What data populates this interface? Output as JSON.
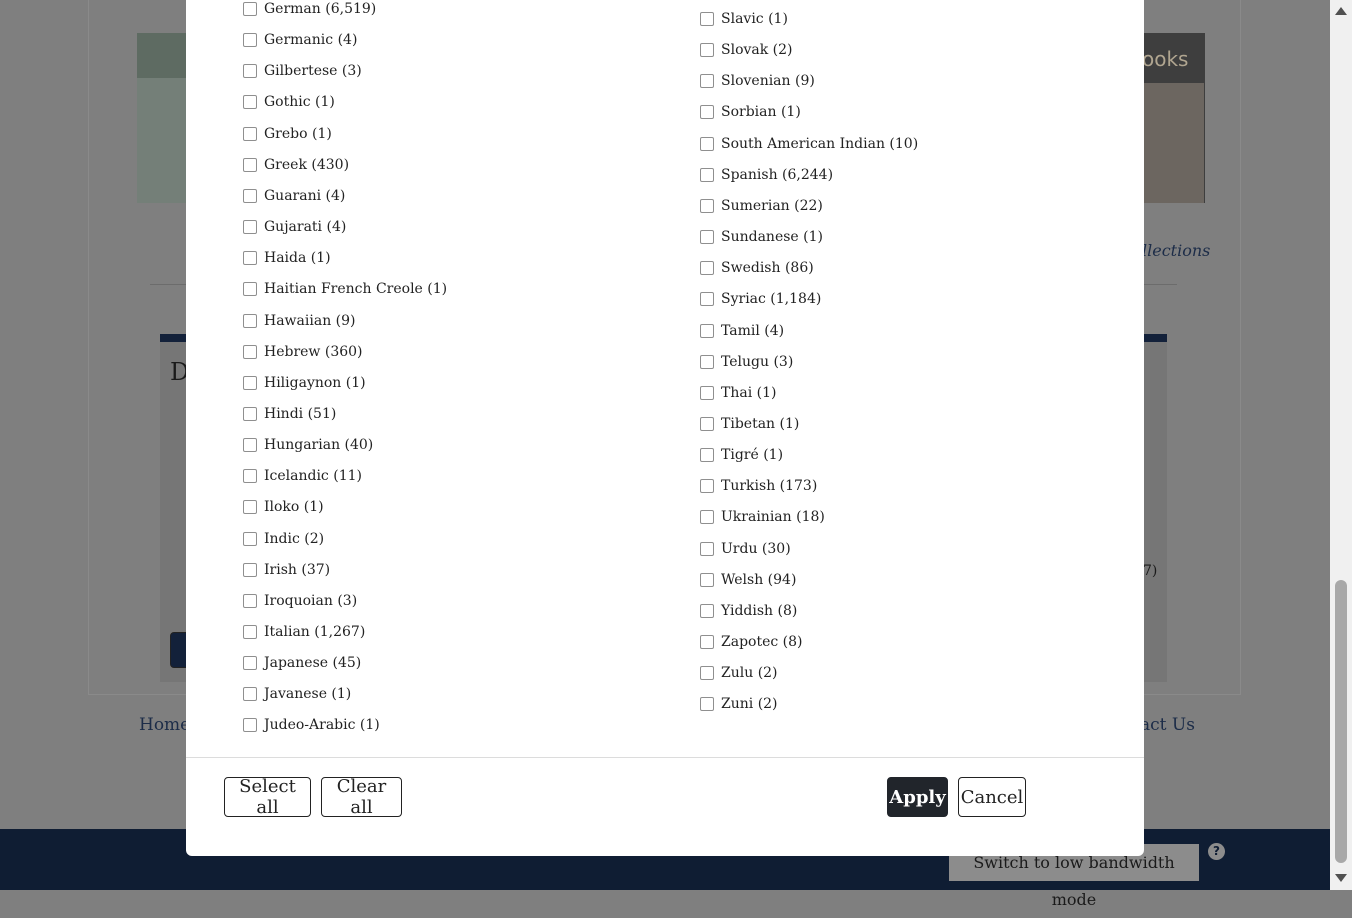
{
  "background": {
    "banner_text": "ooks",
    "collections_link": "llections",
    "panel_heading": "D",
    "side_count": "7)",
    "footer_links": [
      "Home",
      "act Us"
    ],
    "low_bandwidth_button": "Switch to low bandwidth mode",
    "help_badge": "?"
  },
  "modal": {
    "left_column": [
      "German (6,519)",
      "Germanic (4)",
      "Gilbertese (3)",
      "Gothic (1)",
      "Grebo (1)",
      "Greek (430)",
      "Guarani (4)",
      "Gujarati (4)",
      "Haida (1)",
      "Haitian French Creole (1)",
      "Hawaiian (9)",
      "Hebrew (360)",
      "Hiligaynon (1)",
      "Hindi (51)",
      "Hungarian (40)",
      "Icelandic (11)",
      "Iloko (1)",
      "Indic (2)",
      "Irish (37)",
      "Iroquoian (3)",
      "Italian (1,267)",
      "Japanese (45)",
      "Javanese (1)",
      "Judeo-Arabic (1)"
    ],
    "right_column": [
      "Slavic (1)",
      "Slovak (2)",
      "Slovenian (9)",
      "Sorbian (1)",
      "South American Indian (10)",
      "Spanish (6,244)",
      "Sumerian (22)",
      "Sundanese (1)",
      "Swedish (86)",
      "Syriac (1,184)",
      "Tamil (4)",
      "Telugu (3)",
      "Thai (1)",
      "Tibetan (1)",
      "Tigré (1)",
      "Turkish (173)",
      "Ukrainian (18)",
      "Urdu (30)",
      "Welsh (94)",
      "Yiddish (8)",
      "Zapotec (8)",
      "Zulu (2)",
      "Zuni (2)"
    ],
    "buttons": {
      "select_all": "Select all",
      "clear_all": "Clear all",
      "apply": "Apply",
      "cancel": "Cancel"
    }
  },
  "colors": {
    "navy": "#0f1d33",
    "primary_button": "#21252b",
    "overlay_gray": "#7f7f7f"
  }
}
